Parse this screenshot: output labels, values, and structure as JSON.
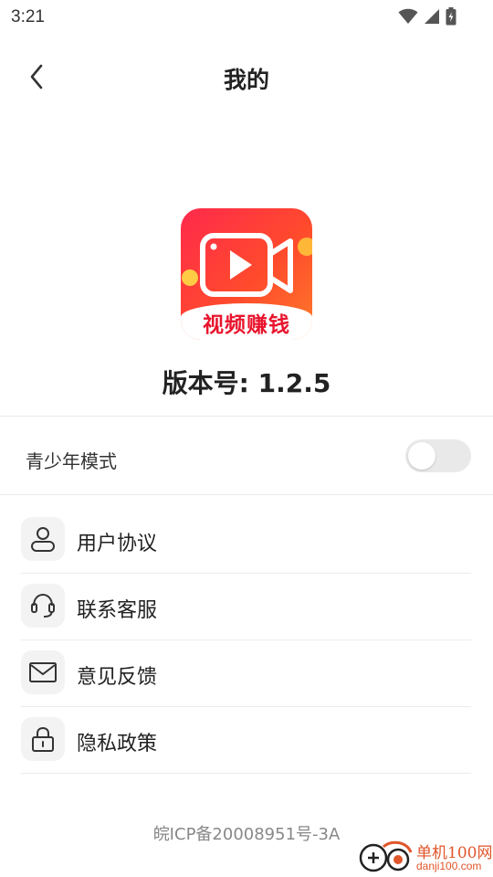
{
  "status_bar": {
    "time": "3:21"
  },
  "nav": {
    "title": "我的"
  },
  "app": {
    "logo_text": "视频赚钱",
    "version": "版本号: 1.2.5"
  },
  "youth_mode": {
    "label": "青少年模式",
    "enabled": false
  },
  "menu": {
    "items": [
      {
        "label": "用户协议",
        "icon": "user-icon"
      },
      {
        "label": "联系客服",
        "icon": "headset-icon"
      },
      {
        "label": "意见反馈",
        "icon": "mail-icon"
      },
      {
        "label": "隐私政策",
        "icon": "lock-icon"
      }
    ]
  },
  "footer": {
    "icp": "皖ICP备20008951号-3A"
  },
  "watermark": {
    "name": "单机100网",
    "url": "danji100.com"
  },
  "colors": {
    "brand_red": "#ff2a4c",
    "logo_orange": "#ff7a2a",
    "watermark_orange": "#e0562a"
  }
}
